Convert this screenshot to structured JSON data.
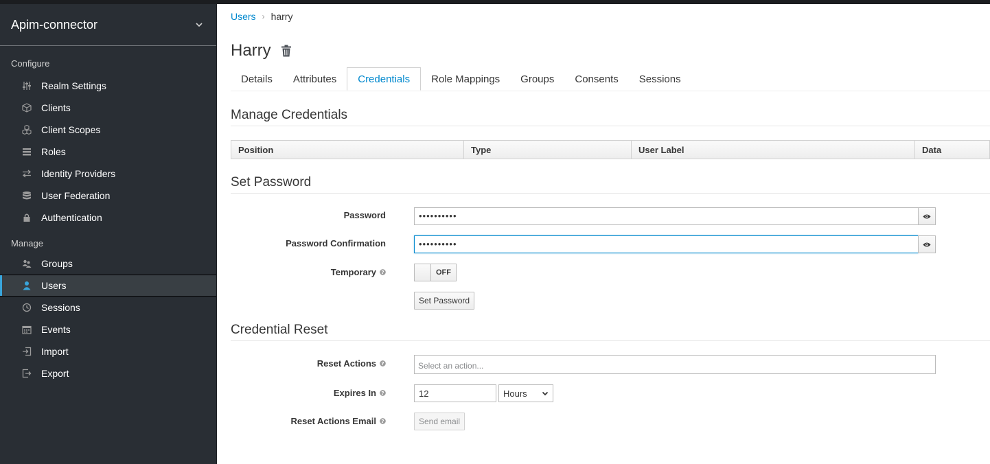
{
  "sidebar": {
    "realm_name": "Apim-connector",
    "configure_title": "Configure",
    "manage_title": "Manage",
    "configure_items": [
      {
        "label": "Realm Settings",
        "icon": "sliders-icon"
      },
      {
        "label": "Clients",
        "icon": "cube-icon"
      },
      {
        "label": "Client Scopes",
        "icon": "cubes-icon"
      },
      {
        "label": "Roles",
        "icon": "list-icon"
      },
      {
        "label": "Identity Providers",
        "icon": "exchange-icon"
      },
      {
        "label": "User Federation",
        "icon": "database-icon"
      },
      {
        "label": "Authentication",
        "icon": "lock-icon"
      }
    ],
    "manage_items": [
      {
        "label": "Groups",
        "icon": "users-icon"
      },
      {
        "label": "Users",
        "icon": "user-icon",
        "active": true
      },
      {
        "label": "Sessions",
        "icon": "clock-icon"
      },
      {
        "label": "Events",
        "icon": "calendar-icon"
      },
      {
        "label": "Import",
        "icon": "import-icon"
      },
      {
        "label": "Export",
        "icon": "export-icon"
      }
    ],
    "active_color": "#39a5dc"
  },
  "breadcrumb": {
    "link": "Users",
    "current": "harry"
  },
  "page": {
    "title": "Harry"
  },
  "tabs": [
    {
      "label": "Details"
    },
    {
      "label": "Attributes"
    },
    {
      "label": "Credentials",
      "active": true
    },
    {
      "label": "Role Mappings"
    },
    {
      "label": "Groups"
    },
    {
      "label": "Consents"
    },
    {
      "label": "Sessions"
    }
  ],
  "manage_credentials": {
    "title": "Manage Credentials",
    "columns": [
      "Position",
      "Type",
      "User Label",
      "Data"
    ]
  },
  "set_password": {
    "title": "Set Password",
    "password_label": "Password",
    "password_value": "••••••••••",
    "confirmation_label": "Password Confirmation",
    "confirmation_value": "••••••••••",
    "temporary_label": "Temporary",
    "temporary_state": "OFF",
    "submit_label": "Set Password"
  },
  "credential_reset": {
    "title": "Credential Reset",
    "reset_actions_label": "Reset Actions",
    "reset_actions_placeholder": "Select an action...",
    "expires_label": "Expires In",
    "expires_value": "12",
    "expires_unit": "Hours",
    "email_label": "Reset Actions Email",
    "email_button": "Send email"
  },
  "colors": {
    "link": "#0088ce",
    "sidebar_bg": "#292e34"
  }
}
